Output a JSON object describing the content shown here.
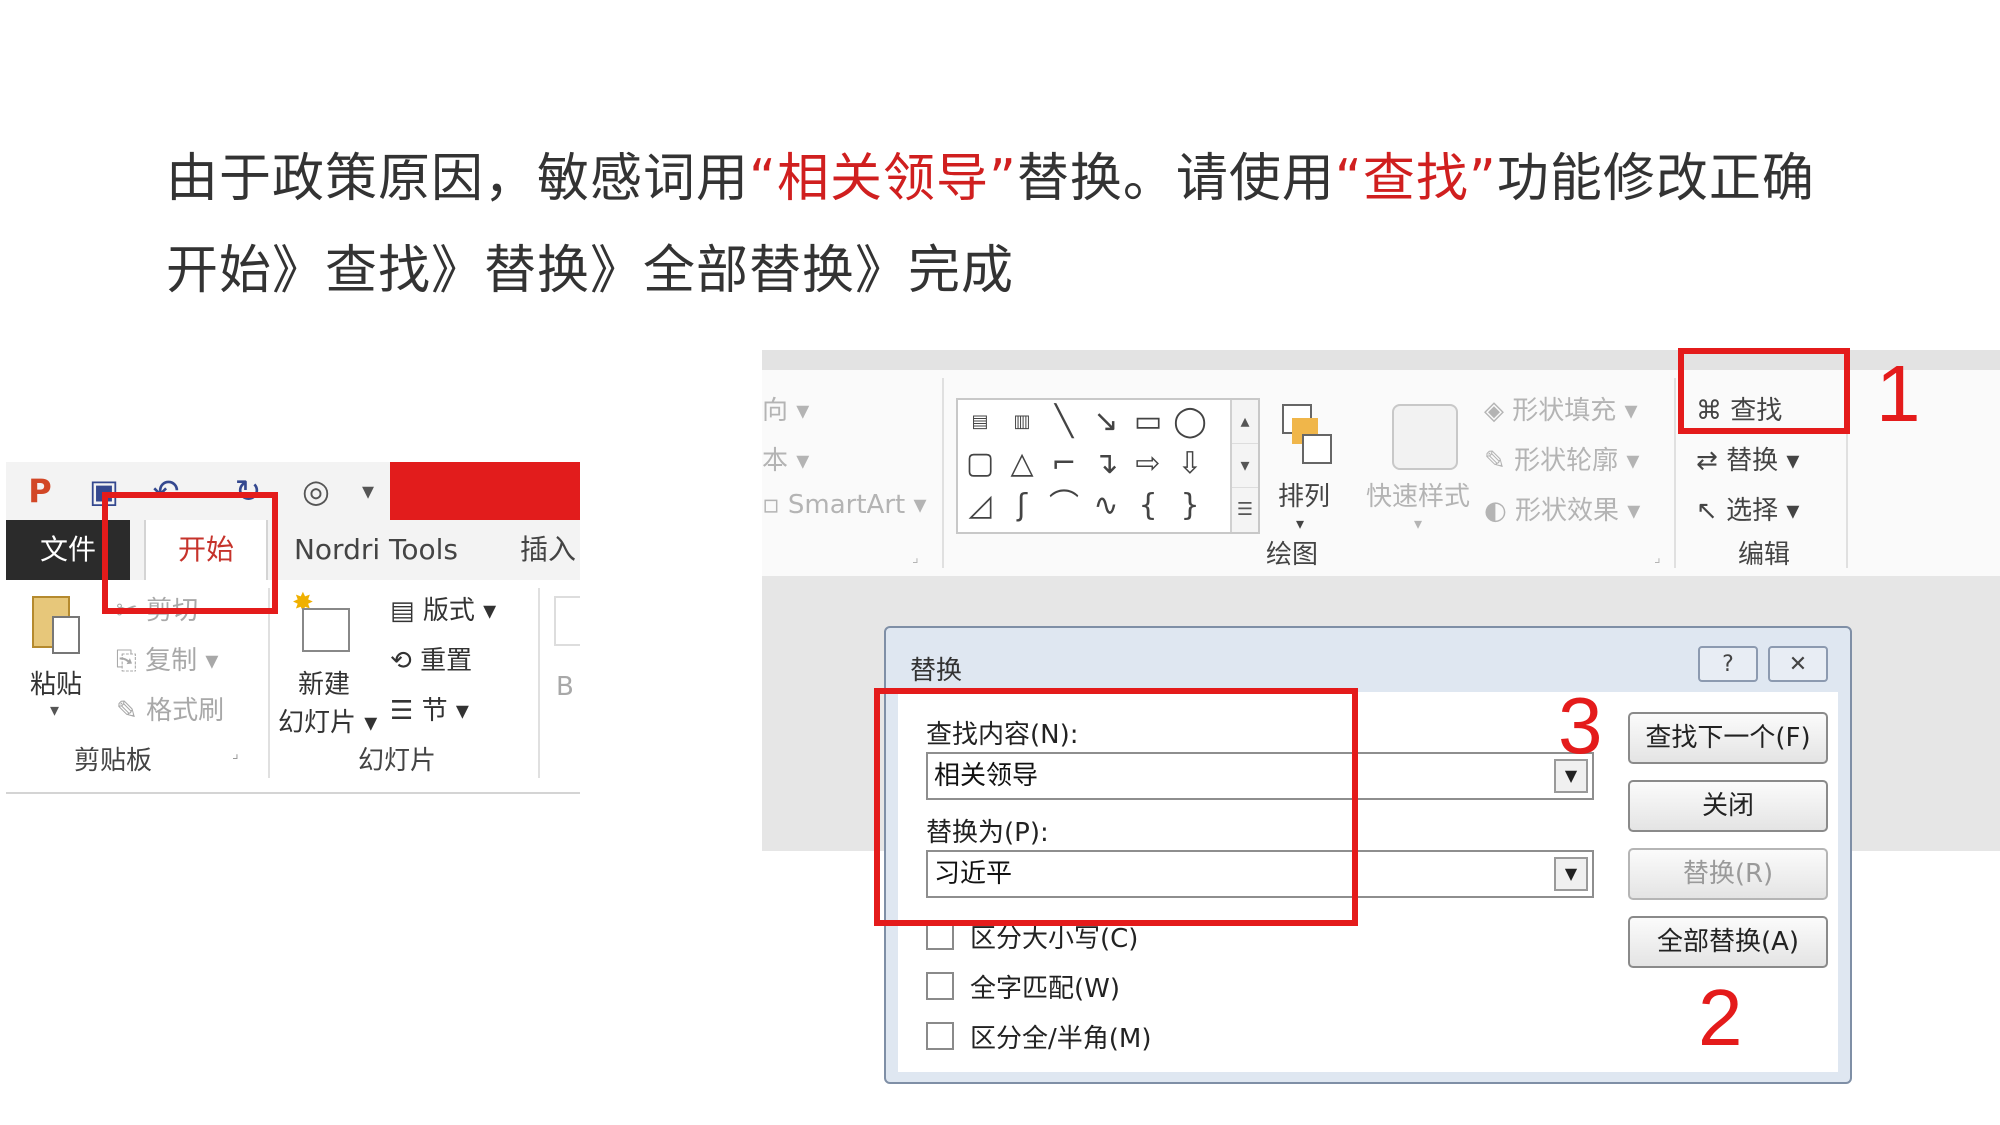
{
  "instructions": {
    "line1": {
      "part1": "由于政策原因，敏感词用",
      "quoted1": "“相关领导”",
      "part2": "替换。请使用",
      "quoted2": "“查找”",
      "part3": "功能修改正确"
    },
    "line2": "开始》查找》替换》全部替换》完成"
  },
  "colors": {
    "highlight_red": "#e41b1b",
    "accent_text_red": "#d01f1f",
    "tab_active": "#c6332b"
  },
  "step_numbers": {
    "step1": "1",
    "step2": "2",
    "step3": "3"
  },
  "left_panel": {
    "qat_icons": [
      "powerpoint-logo-icon",
      "save-icon",
      "undo-icon",
      "redo-icon",
      "present-icon",
      "customize-qat-icon"
    ],
    "tabs": {
      "file": "文件",
      "home": "开始",
      "nordri": "Nordri Tools",
      "insert": "插入"
    },
    "clipboard": {
      "paste": "粘贴",
      "cut": "剪切",
      "copy": "复制",
      "format_painter": "格式刷",
      "group_label": "剪贴板"
    },
    "slides": {
      "new_slide_line1": "新建",
      "new_slide_line2": "幻灯片",
      "layout": "版式",
      "reset": "重置",
      "section": "节",
      "group_label": "幻灯片"
    },
    "font_partial": "B"
  },
  "right_ribbon": {
    "paragraph_partial": {
      "direction": "向",
      "text": "本",
      "smartart": "SmartArt"
    },
    "drawing": {
      "arrange": "排列",
      "quick_styles": "快速样式",
      "shape_fill": "形状填充",
      "shape_outline": "形状轮廓",
      "shape_effects": "形状效果",
      "group_label": "绘图"
    },
    "editing": {
      "find": "查找",
      "replace": "替换",
      "select": "选择",
      "group_label": "编辑"
    }
  },
  "dialog": {
    "title": "替换",
    "help_button": "?",
    "close_button": "✕",
    "find_label": "查找内容(N):",
    "find_value": "相关领导",
    "replace_label": "替换为(P):",
    "replace_value": "习近平",
    "buttons": {
      "find_next": "查找下一个(F)",
      "close": "关闭",
      "replace": "替换(R)",
      "replace_all": "全部替换(A)"
    },
    "options": {
      "match_case": "区分大小写(C)",
      "whole_word": "全字匹配(W)",
      "match_width": "区分全/半角(M)"
    }
  }
}
